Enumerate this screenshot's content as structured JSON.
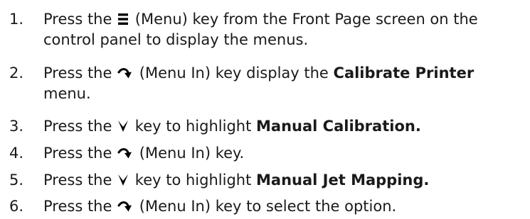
{
  "steps": [
    {
      "number": "1.",
      "pre": "Press the",
      "icon": "menu-icon",
      "post": "(Menu) key from the Front Page screen on the control panel to display the menus."
    },
    {
      "number": "2.",
      "pre": "Press the",
      "icon": "menu-in-arrow-icon",
      "post": "(Menu In) key display the",
      "bold": "Calibrate Printer",
      "post2": "menu."
    },
    {
      "number": "3.",
      "pre": "Press the",
      "icon": "down-chevron-icon",
      "post": "key to highlight",
      "bold": "Manual Calibration."
    },
    {
      "number": "4.",
      "pre": "Press the",
      "icon": "menu-in-arrow-icon",
      "post": "(Menu In) key."
    },
    {
      "number": "5.",
      "pre": "Press the",
      "icon": "down-chevron-icon",
      "post": "key to highlight",
      "bold": "Manual Jet Mapping."
    },
    {
      "number": "6.",
      "pre": "Press the",
      "icon": "menu-in-arrow-icon",
      "post": "(Menu In) key to select the option."
    }
  ]
}
